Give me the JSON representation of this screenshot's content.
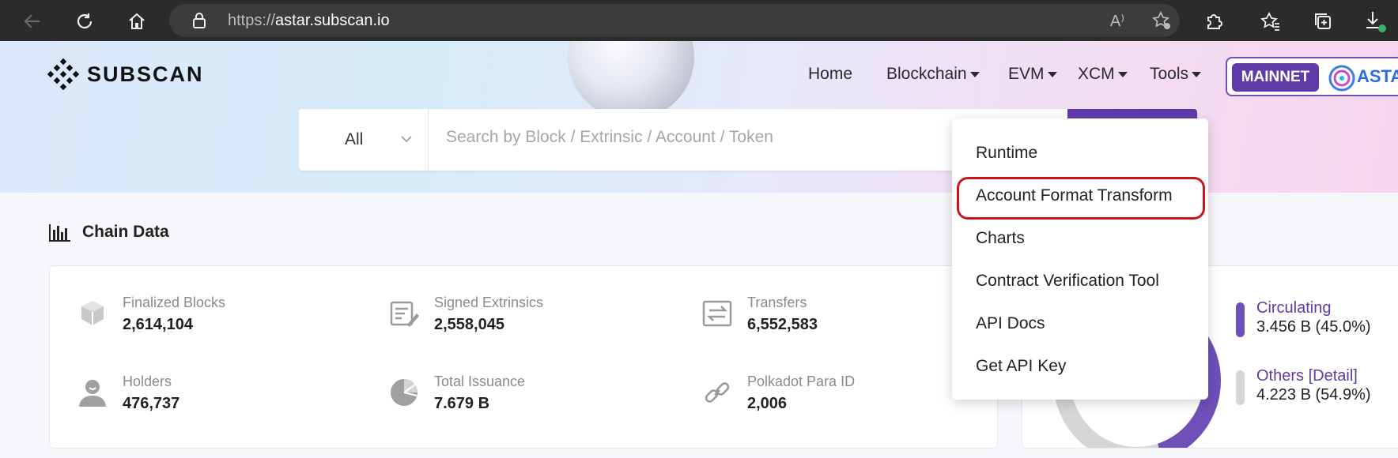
{
  "browser": {
    "url_proto": "https://",
    "url_host": "astar.subscan.io"
  },
  "header": {
    "logo_text": "SUBSCAN",
    "nav": [
      {
        "label": "Home"
      },
      {
        "label": "Blockchain"
      },
      {
        "label": "EVM"
      },
      {
        "label": "XCM"
      },
      {
        "label": "Tools"
      }
    ],
    "network_button": "MAINNET",
    "network_name": "ASTA"
  },
  "search": {
    "filter_value": "All",
    "placeholder": "Search by Block / Extrinsic / Account / Token"
  },
  "tools_menu": {
    "items": [
      {
        "label": "Runtime"
      },
      {
        "label": "Account Format Transform"
      },
      {
        "label": "Charts"
      },
      {
        "label": "Contract Verification Tool"
      },
      {
        "label": "API Docs"
      },
      {
        "label": "Get API Key"
      }
    ]
  },
  "chain_data": {
    "title": "Chain Data",
    "stats": [
      {
        "label": "Finalized Blocks",
        "value": "2,614,104",
        "icon": "block-cube-icon"
      },
      {
        "label": "Signed Extrinsics",
        "value": "2,558,045",
        "icon": "document-sign-icon"
      },
      {
        "label": "Transfers",
        "value": "6,552,583",
        "icon": "transfer-arrows-icon"
      },
      {
        "label": "Holders",
        "value": "476,737",
        "icon": "user-icon"
      },
      {
        "label": "Total Issuance",
        "value": "7.679 B",
        "icon": "pie-icon"
      },
      {
        "label": "Polkadot Para ID",
        "value": "2,006",
        "icon": "link-icon"
      }
    ]
  },
  "token_distribution": {
    "circulating_label": "Circulating",
    "circulating_value": "3.456 B  (45.0%)",
    "circulating_fraction": 0.45,
    "others_label": "Others",
    "others_detail": "[Detail]",
    "others_value": "4.223 B  (54.9%)",
    "colors": {
      "circulating": "#6f4fb8",
      "others": "#d6d6d6"
    }
  }
}
